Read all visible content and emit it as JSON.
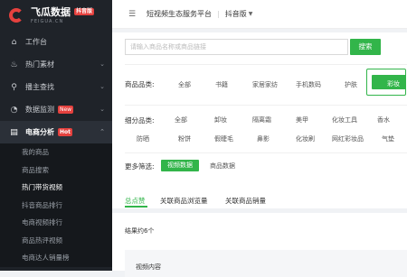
{
  "brand": {
    "title": "飞瓜数据",
    "badge": "抖音版",
    "subtitle": "FEIGUA.CN"
  },
  "sidebar": {
    "items": [
      {
        "label": "工作台",
        "icon": "home-icon"
      },
      {
        "label": "热门素材",
        "icon": "flame-icon"
      },
      {
        "label": "播主查找",
        "icon": "search-icon"
      },
      {
        "label": "数据监测",
        "icon": "monitor-icon",
        "badge": "New"
      },
      {
        "label": "电商分析",
        "icon": "cart-icon",
        "badge": "Hot"
      }
    ],
    "sub_items": [
      "我的商品",
      "商品搜索",
      "热门带货视频",
      "抖音商品排行",
      "电商视频排行",
      "商品热评视频",
      "电商达人销量榜"
    ]
  },
  "topbar": {
    "title": "短视频生态服务平台",
    "separator": "|",
    "version": "抖音版"
  },
  "search": {
    "placeholder": "请输入商品名称或商品链接",
    "button": "搜索"
  },
  "filters": {
    "category_label": "商品品类:",
    "categories": [
      "全部",
      "书籍",
      "家居家纺",
      "手机数码",
      "护肤",
      "彩妆"
    ],
    "selected_category": "彩妆",
    "subcategory_label": "细分品类:",
    "subcategories_row1": [
      "全部",
      "卸妆",
      "隔离霜",
      "美甲",
      "化妆工具",
      "香水"
    ],
    "subcategories_row2": [
      "防晒",
      "粉饼",
      "假睫毛",
      "鼻影",
      "化妆刷",
      "网红彩妆品",
      "气垫"
    ],
    "more_label": "更多筛选:",
    "more_options": [
      "视频数据",
      "商品数据"
    ]
  },
  "tabs": [
    "总点赞",
    "关联商品浏览量",
    "关联商品销量"
  ],
  "result": {
    "count_text": "结果约6个",
    "column_header": "视频内容"
  },
  "colors": {
    "accent": "#32b54a",
    "brand_red": "#e5413e",
    "sidebar_bg": "#1f2329"
  }
}
